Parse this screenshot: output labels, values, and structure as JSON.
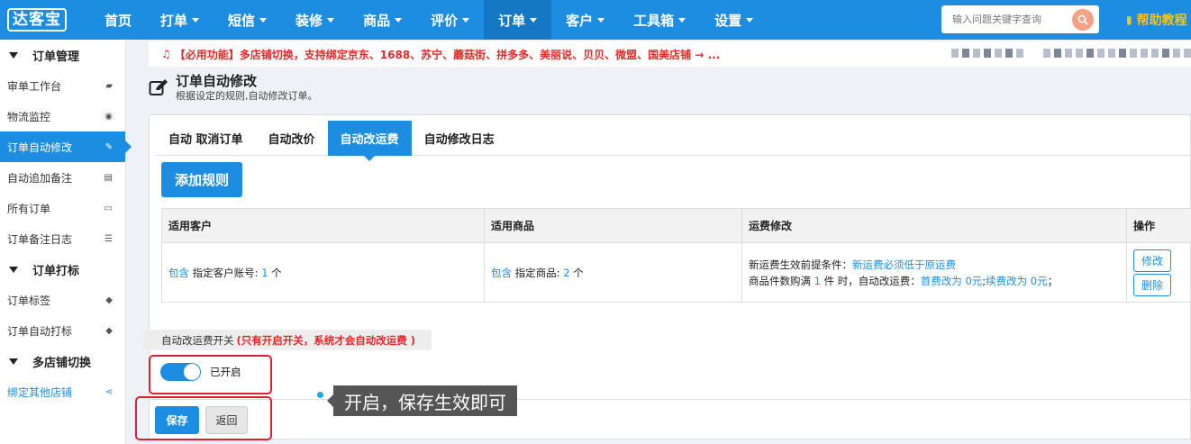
{
  "logo": "达客宝",
  "nav": {
    "items": [
      {
        "label": "首页",
        "dropdown": false
      },
      {
        "label": "打单",
        "dropdown": true
      },
      {
        "label": "短信",
        "dropdown": true
      },
      {
        "label": "装修",
        "dropdown": true
      },
      {
        "label": "商品",
        "dropdown": true
      },
      {
        "label": "评价",
        "dropdown": true
      },
      {
        "label": "订单",
        "dropdown": true,
        "active": true
      },
      {
        "label": "客户",
        "dropdown": true
      },
      {
        "label": "工具箱",
        "dropdown": true
      },
      {
        "label": "设置",
        "dropdown": true
      }
    ],
    "search_placeholder": "输入问题关键字查询",
    "help": "帮助教程"
  },
  "sidebar": {
    "group1": "订单管理",
    "group1_items": [
      {
        "label": "审单工作台",
        "icon": "truck-icon",
        "glyph": "▰"
      },
      {
        "label": "物流监控",
        "icon": "eye-icon",
        "glyph": "◉"
      },
      {
        "label": "订单自动修改",
        "icon": "edit-icon",
        "glyph": "✎",
        "active": true
      },
      {
        "label": "自动追加备注",
        "icon": "list-alt-icon",
        "glyph": "▤"
      },
      {
        "label": "所有订单",
        "icon": "credit-card-icon",
        "glyph": "▭"
      },
      {
        "label": "订单备注日志",
        "icon": "list-icon",
        "glyph": "☰"
      }
    ],
    "group2": "订单打标",
    "group2_items": [
      {
        "label": "订单标签",
        "icon": "tags-icon",
        "glyph": "◆"
      },
      {
        "label": "订单自动打标",
        "icon": "tag-icon",
        "glyph": "◆"
      }
    ],
    "group3": "多店铺切换",
    "group3_items": [
      {
        "label": "绑定其他店铺",
        "icon": "share-icon",
        "glyph": "⋖",
        "link": true
      }
    ]
  },
  "notice": "【必用功能】多店铺切换，支持绑定京东、1688、苏宁、蘑菇街、拼多多、美丽说、贝贝、微盟、国美店铺 → ...",
  "page": {
    "title": "订单自动修改",
    "subtitle": "根据设定的规则,自动修改订单。"
  },
  "tabs": [
    "自动 取消订单",
    "自动改价",
    "自动改运费",
    "自动修改日志"
  ],
  "add_rule": "添加规则",
  "table": {
    "headers": [
      "适用客户",
      "适用商品",
      "运费修改",
      "操作"
    ],
    "row": {
      "customer_link": "包含",
      "customer_text": "指定客户账号:",
      "customer_count": "1",
      "customer_unit": "个",
      "goods_link": "包含",
      "goods_text": "指定商品:",
      "goods_count": "2",
      "goods_unit": "个",
      "cond_prefix": "新运费生效前提条件：",
      "cond_value": "新运费必须低于原运费",
      "rule_a": "商品件数购满",
      "rule_num": "1",
      "rule_b": "件 时，自动改运费：",
      "first_fee": "首费改为 0元",
      "sep": ";",
      "extra_fee": "续费改为 0元",
      "end": "；",
      "edit": "修改",
      "delete": "删除"
    }
  },
  "switch": {
    "label": "自动改运费开关",
    "warning": "(只有开启开关，系统才会自动改运费 )",
    "state": "已开启",
    "on": true
  },
  "buttons": {
    "save": "保存",
    "back": "返回"
  },
  "callout": "开启，保存生效即可",
  "colors": {
    "primary": "#1c8de0",
    "danger": "#e02a2a",
    "help": "#f5c518"
  }
}
